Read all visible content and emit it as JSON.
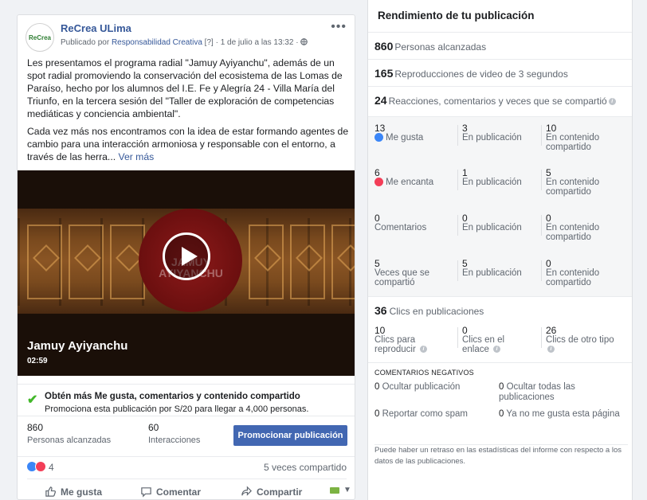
{
  "post": {
    "avatar_text": "ReCrea",
    "page_name": "ReCrea ULima",
    "meta_prefix": "Publicado por ",
    "meta_author": "Responsabilidad Creativa",
    "meta_suffix": " [?] · 1 de julio a las 13:32 · ",
    "globe_icon": "globe-icon",
    "text_p1": "Les presentamos el programa radial \"Jamuy Ayiyanchu\", además de un spot radial promoviendo la conservación del ecosistema de las Lomas de Paraíso, hecho por los alumnos del I.E. Fe y Alegría 24 - Villa María del Triunfo, en la tercera sesión del \"Taller de exploración de competencias mediáticas y conciencia ambiental\".",
    "text_p2": "Cada vez más nos encontramos con la idea de estar formando agentes de cambio para una interacción armoniosa y responsable con el entorno, a través de las herra...",
    "see_more": "Ver más",
    "video": {
      "title": "Jamuy Ayiyanchu",
      "duration": "02:59",
      "watermark": "JAMUY AYIYANCHU"
    },
    "boost": {
      "title": "Obtén más Me gusta, comentarios y contenido compartido",
      "subtitle": "Promociona esta publicación por S/20 para llegar a 4,000 personas."
    },
    "stats": {
      "reach_value": "860",
      "reach_label": "Personas alcanzadas",
      "interactions_value": "60",
      "interactions_label": "Interacciones",
      "promote_label": "Promocionar publicación"
    },
    "reactions_count": "4",
    "shares_text": "5 veces compartido",
    "actions": {
      "like": "Me gusta",
      "comment": "Comentar",
      "share": "Compartir"
    }
  },
  "insights": {
    "title": "Rendimiento de tu publicación",
    "reach": {
      "value": "860",
      "label": "Personas alcanzadas"
    },
    "video_views": {
      "value": "165",
      "label": "Reproducciones de video de 3 segundos"
    },
    "engagement": {
      "value": "24",
      "label": "Reacciones, comentarios y veces que se compartió"
    },
    "rows": [
      {
        "total": "13",
        "label": "Me gusta",
        "icon": "like-icon",
        "on_post": "3",
        "on_post_label": "En publicación",
        "shared": "10",
        "shared_label": "En contenido compartido"
      },
      {
        "total": "6",
        "label": "Me encanta",
        "icon": "love-icon",
        "on_post": "1",
        "on_post_label": "En publicación",
        "shared": "5",
        "shared_label": "En contenido compartido"
      },
      {
        "total": "0",
        "label": "Comentarios",
        "icon": "",
        "on_post": "0",
        "on_post_label": "En publicación",
        "shared": "0",
        "shared_label": "En contenido compartido"
      },
      {
        "total": "5",
        "label": "Veces que se compartió",
        "icon": "",
        "on_post": "5",
        "on_post_label": "En publicación",
        "shared": "0",
        "shared_label": "En contenido compartido"
      }
    ],
    "clicks": {
      "value": "36",
      "label": "Clics en publicaciones",
      "items": [
        {
          "value": "10",
          "label": "Clics para reproducir"
        },
        {
          "value": "0",
          "label": "Clics en el enlace"
        },
        {
          "value": "26",
          "label": "Clics de otro tipo"
        }
      ]
    },
    "negative": {
      "title": "COMENTARIOS NEGATIVOS",
      "hide_post": {
        "value": "0",
        "label": "Ocultar publicación"
      },
      "hide_all": {
        "value": "0",
        "label": "Ocultar todas las publicaciones"
      },
      "spam": {
        "value": "0",
        "label": "Reportar como spam"
      },
      "unlike": {
        "value": "0",
        "label": "Ya no me gusta esta página"
      }
    },
    "footnote": "Puede haber un retraso en las estadísticas del informe con respecto a los datos de las publicaciones."
  },
  "colors": {
    "link": "#365899",
    "primary_button": "#4267b2",
    "like_blue": "#3b86f7",
    "love_red": "#f33e58",
    "check_green": "#42b72a"
  }
}
